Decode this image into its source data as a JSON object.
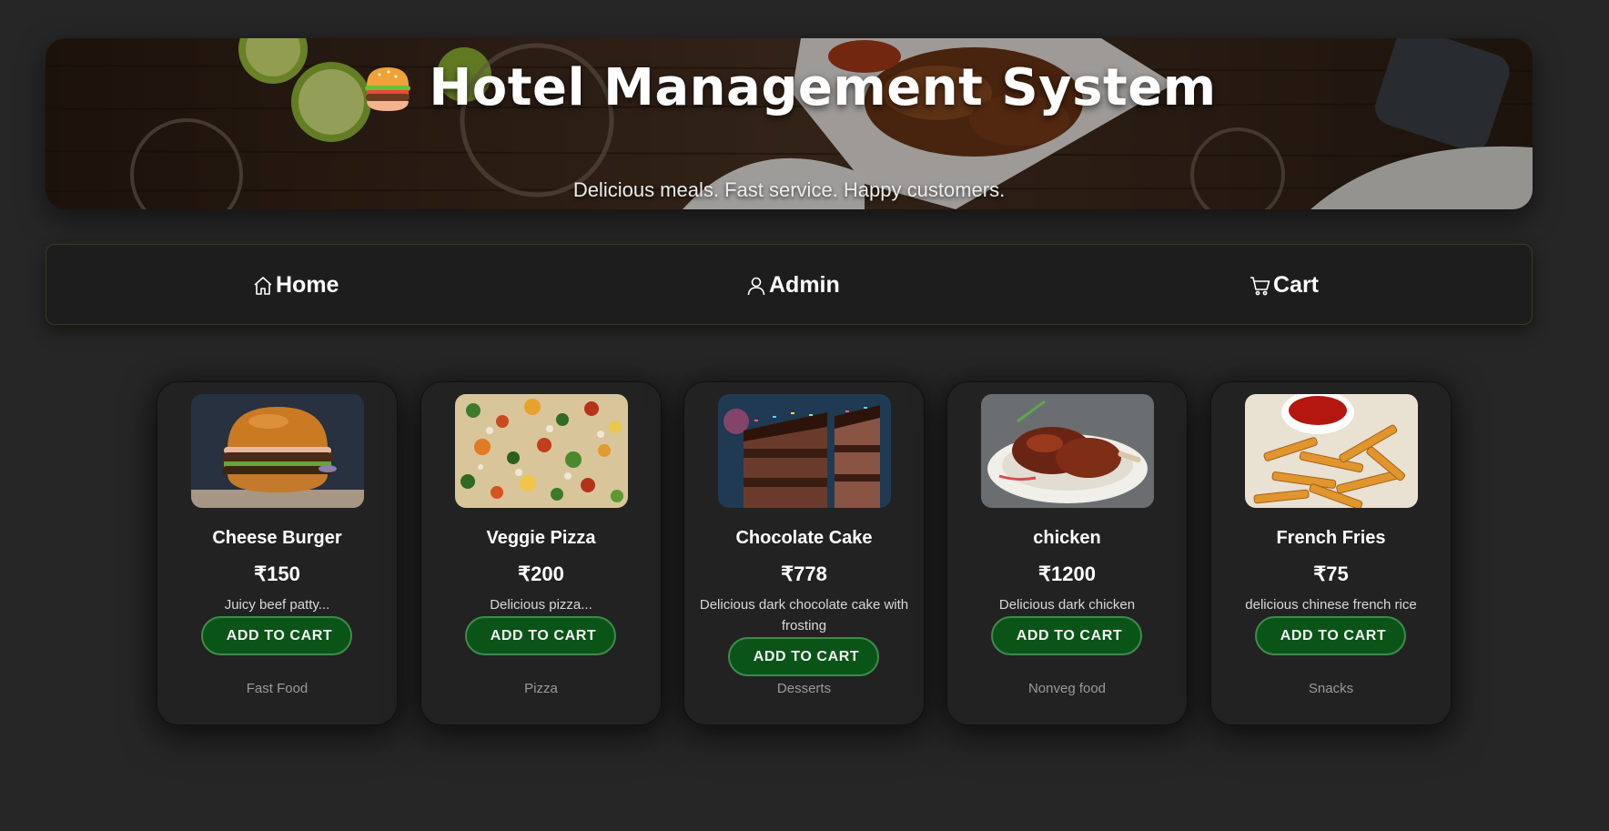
{
  "header": {
    "title": "Hotel Management System",
    "subtitle": "Delicious meals. Fast service. Happy customers.",
    "logo_icon": "burger-icon"
  },
  "nav": {
    "items": [
      {
        "label": "Home",
        "icon": "home-icon"
      },
      {
        "label": "Admin",
        "icon": "user-icon"
      },
      {
        "label": "Cart",
        "icon": "cart-icon"
      }
    ]
  },
  "products": [
    {
      "name": "Cheese Burger",
      "price": "₹150",
      "description": "Juicy beef patty...",
      "button": "ADD TO CART",
      "category": "Fast Food",
      "image": "cheese-burger-image"
    },
    {
      "name": "Veggie Pizza",
      "price": "₹200",
      "description": "Delicious pizza...",
      "button": "ADD TO CART",
      "category": "Pizza",
      "image": "veggie-pizza-image"
    },
    {
      "name": "Chocolate Cake",
      "price": "₹778",
      "description": "Delicious dark chocolate cake with frosting",
      "button": "ADD TO CART",
      "category": "Desserts",
      "image": "chocolate-cake-image"
    },
    {
      "name": "chicken",
      "price": "₹1200",
      "description": "Delicious dark chicken",
      "button": "ADD TO CART",
      "category": "Nonveg food",
      "image": "chicken-image"
    },
    {
      "name": "French Fries",
      "price": "₹75",
      "description": "delicious chinese french rice",
      "button": "ADD TO CART",
      "category": "Snacks",
      "image": "french-fries-image"
    }
  ],
  "colors": {
    "background": "#262626",
    "card": "#222222",
    "button": "#0a5418",
    "button_border": "#3f8a4c"
  }
}
